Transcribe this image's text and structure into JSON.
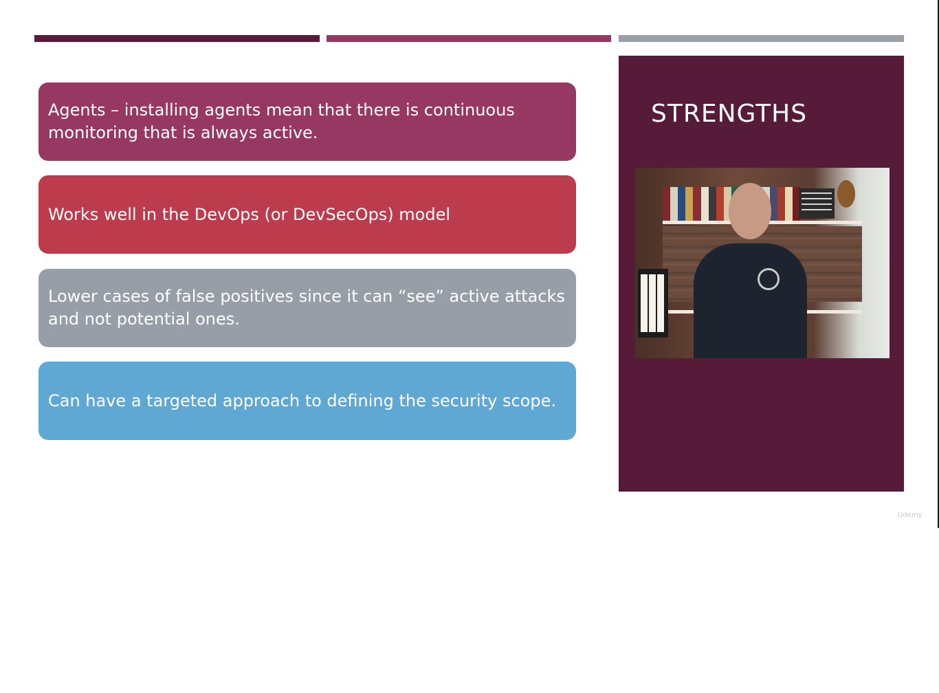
{
  "slide": {
    "cards": [
      {
        "text": "Agents – installing agents mean that there is continuous monitoring that is always active."
      },
      {
        "text": "Works well in the DevOps (or DevSecOps) model"
      },
      {
        "text": "Lower cases of false positives since it can “see” active attacks and not potential ones."
      },
      {
        "text": "Can have a targeted approach to defining the security scope."
      }
    ],
    "side_title": "STRENGTHS",
    "watermark": "Udemy"
  },
  "colors": {
    "accent_dark": "#561b39",
    "accent_plum": "#963862",
    "accent_red": "#bc3b4c",
    "accent_gray": "#979ea8",
    "accent_blue": "#5fa8d3"
  }
}
